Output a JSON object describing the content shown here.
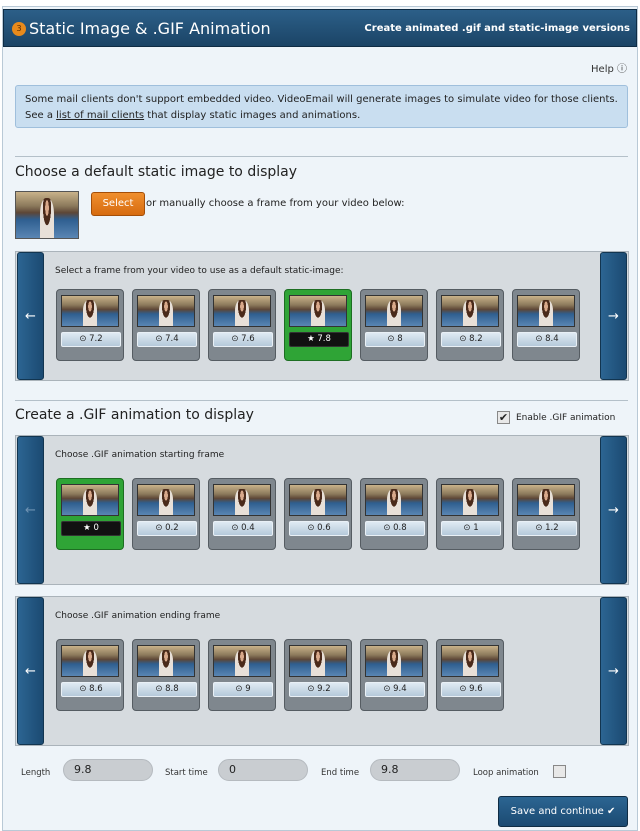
{
  "header": {
    "step": "3",
    "title": "Static Image & .GIF Animation",
    "subtitle": "Create animated .gif and static-image versions"
  },
  "help": {
    "label": "Help ⓘ"
  },
  "info": {
    "line1": "Some mail clients don't support embedded video. VideoEmail will generate images to simulate video for those clients.",
    "line2_pre": "See a ",
    "link": "list of mail clients",
    "line2_post": " that display static images and animations."
  },
  "static": {
    "title": "Choose a default static image to display",
    "select_label": "Select",
    "or_text": "or manually choose a frame from your video below:",
    "panel_label": "Select a frame from your video to use as a default static-image:",
    "frames": [
      {
        "t": "7.2"
      },
      {
        "t": "7.4"
      },
      {
        "t": "7.6"
      },
      {
        "t": "7.8",
        "selected": true
      },
      {
        "t": "8"
      },
      {
        "t": "8.2"
      },
      {
        "t": "8.4"
      }
    ]
  },
  "gif": {
    "title": "Create a .GIF animation to display",
    "enable_label": "Enable .GIF animation",
    "enabled": true,
    "start_label": "Choose .GIF animation starting frame",
    "start_frames": [
      {
        "t": "0",
        "selected": true
      },
      {
        "t": "0.2"
      },
      {
        "t": "0.4"
      },
      {
        "t": "0.6"
      },
      {
        "t": "0.8"
      },
      {
        "t": "1"
      },
      {
        "t": "1.2"
      }
    ],
    "end_label": "Choose .GIF animation ending frame",
    "end_frames": [
      {
        "t": "8.6"
      },
      {
        "t": "8.8"
      },
      {
        "t": "9"
      },
      {
        "t": "9.2"
      },
      {
        "t": "9.4"
      },
      {
        "t": "9.6"
      }
    ]
  },
  "fields": {
    "length_label": "Length",
    "length": "9.8",
    "start_label": "Start time",
    "start": "0",
    "end_label": "End time",
    "end": "9.8",
    "loop_label": "Loop animation",
    "loop": false
  },
  "save_label": "Save and continue ✔",
  "icons": {
    "left": "←",
    "right": "→",
    "clock": "⊙",
    "star": "★",
    "check": "✔"
  }
}
